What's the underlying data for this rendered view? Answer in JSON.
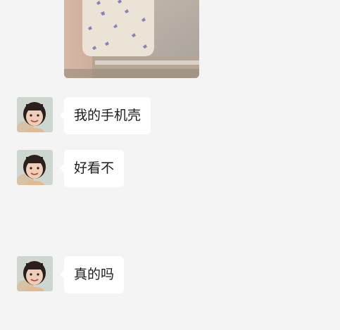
{
  "chat": {
    "messages": [
      {
        "type": "image",
        "description_icon": "phone-case-photo"
      },
      {
        "type": "text",
        "text": "我的手机壳"
      },
      {
        "type": "text",
        "text": "好看不"
      },
      {
        "type": "text",
        "text": "真的吗"
      }
    ]
  },
  "colors": {
    "background": "#f4f4f4",
    "bubble": "#ffffff",
    "text": "#1c1c1c"
  }
}
